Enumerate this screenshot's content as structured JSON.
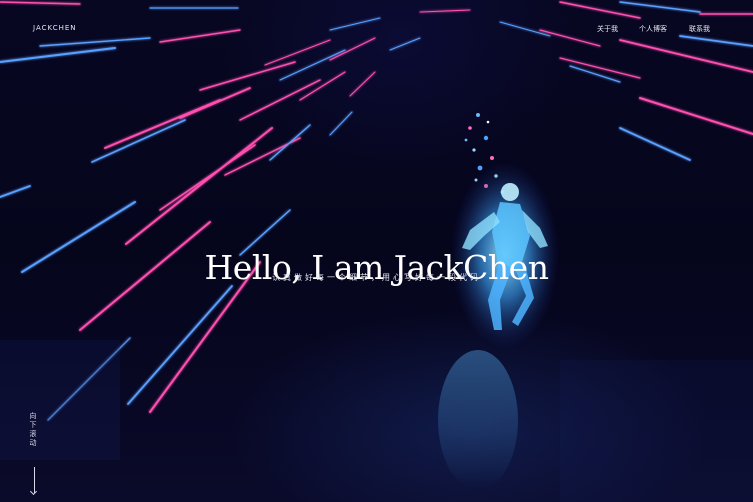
{
  "header": {
    "logo": "JACKCHEN",
    "nav": [
      {
        "label": "关于我",
        "icon": "user-icon"
      },
      {
        "label": "个人博客",
        "icon": "edit-icon"
      },
      {
        "label": "联系我",
        "icon": ""
      }
    ]
  },
  "hero": {
    "title": "Hello, I am JackChen",
    "subtitle": "认真做好每一个细节，用心写好每一段代码"
  },
  "scroll_hint": {
    "label": "向下滚动",
    "icon": "arrow-down-icon"
  },
  "colors": {
    "background": "#05051c",
    "streak_pink": "#ff4fb0",
    "streak_blue": "#5aa0ff",
    "text": "#ffffff"
  }
}
